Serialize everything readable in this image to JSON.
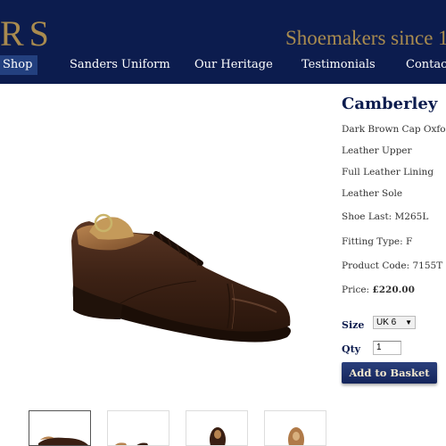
{
  "header": {
    "brand_left": "RS",
    "brand_right": "Shoemakers since 1",
    "nav": [
      "Shop",
      "Sanders Uniform",
      "Our Heritage",
      "Testimonials",
      "Contact"
    ]
  },
  "product": {
    "title": "Camberley",
    "specs": [
      "Dark Brown Cap Oxford",
      "Leather Upper",
      "Full Leather Lining",
      "Leather Sole",
      "Shoe Last: M265L",
      "Fitting Type: F",
      "Product Code: 7155T"
    ],
    "price_label": "Price: ",
    "price_value": "£220.00",
    "size_label": "Size",
    "size_value": "UK 6",
    "qty_label": "Qty",
    "qty_value": "1",
    "basket_label": "Add to Basket"
  },
  "thumbnails": [
    "side view",
    "detail view",
    "top view",
    "sole view"
  ],
  "colors": {
    "navy": "#0c1c4e",
    "gold": "#a98b4f",
    "shoe_brown": "#3a1f13"
  }
}
